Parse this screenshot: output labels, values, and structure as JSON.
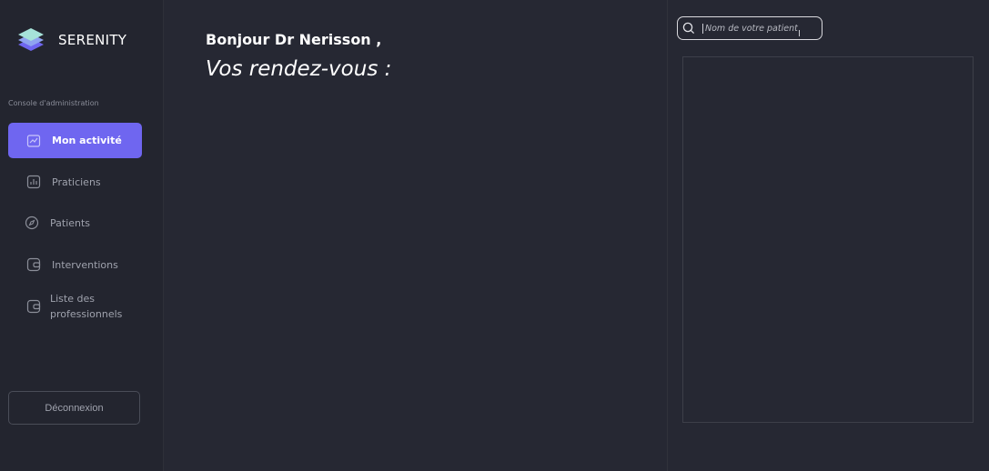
{
  "brand": {
    "name": "SERENITY",
    "logo_icon": "layers-logo-icon",
    "logo_colors": [
      "#a6e3d9",
      "#8fa3f0",
      "#6f66f0"
    ]
  },
  "sidebar": {
    "section_label": "Console d'administration",
    "items": [
      {
        "label": "Mon activité",
        "icon": "activity-chart-icon",
        "active": true
      },
      {
        "label": "Praticiens",
        "icon": "bar-chart-icon",
        "active": false
      },
      {
        "label": "Patients",
        "icon": "compass-icon",
        "active": false
      },
      {
        "label": "Interventions",
        "icon": "wallet-icon",
        "active": false
      },
      {
        "label": "Liste des professionnels",
        "icon": "wallet-icon",
        "active": false
      }
    ],
    "logout_label": "Déconnexion"
  },
  "main": {
    "greeting": "Bonjour Dr Nerisson ,",
    "subtitle": "Vos rendez-vous :"
  },
  "search": {
    "placeholder": "Nom de votre patient",
    "icon": "search-icon"
  },
  "colors": {
    "background": "#262833",
    "sidebar": "#23252f",
    "accent": "#6f66f0",
    "text": "#ffffff",
    "muted": "#9fa2ad"
  }
}
